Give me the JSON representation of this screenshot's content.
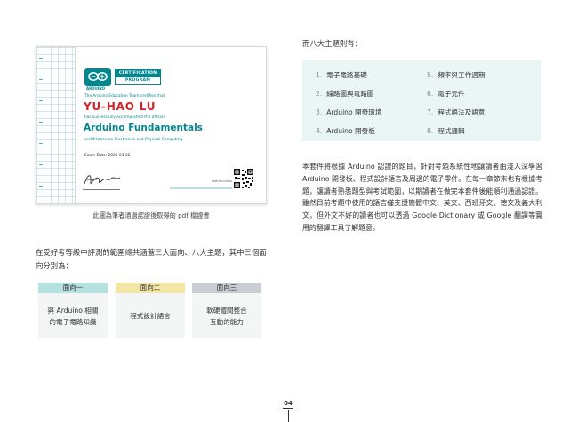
{
  "certificate": {
    "program_line1": "CERTIFICATION",
    "program_line2": "PROGRAM",
    "arduino_word": "ARDUINO",
    "certifies_text": "The Arduino Education Team certifies that",
    "name": "YU-HAO LU",
    "accomplished_text": "has successfully accomplished the official",
    "course": "Arduino Fundamentals",
    "course_sub": "certification on Electronics and Physical Computing",
    "exam_date": "Exam Date:  2020-01-22",
    "verify_label": "CERTIFICATE ID",
    "accent_color": "#00878f",
    "name_color": "#d2232a"
  },
  "caption": "此圖為筆者通過認證後取得的 pdf 檔證書",
  "left_paragraph": "在受好考等級中評測的範圍總共涵蓋三大面向、八大主題，其中三個面向分別為：",
  "aspects": [
    {
      "title": "面向一",
      "body_line1": "與 Arduino 相關",
      "body_line2": "的電子電路知識",
      "color": "#b5e1e1"
    },
    {
      "title": "面向二",
      "body_line1": "程式設計語言",
      "body_line2": "",
      "color": "#f2e7a7"
    },
    {
      "title": "面向三",
      "body_line1": "軟硬體間整合",
      "body_line2": "互動的能力",
      "color": "#c8ced3"
    }
  ],
  "topics_title": "而八大主題則有：",
  "topics": [
    {
      "num": "1.",
      "label": "電子電路基礎"
    },
    {
      "num": "2.",
      "label": "線路圖與電路圖"
    },
    {
      "num": "3.",
      "label": "Arduino 開發環境"
    },
    {
      "num": "4.",
      "label": "Arduino 開發板"
    },
    {
      "num": "5.",
      "label": "頻率與工作週期"
    },
    {
      "num": "6.",
      "label": "電子元件"
    },
    {
      "num": "7.",
      "label": "程式語法及語意"
    },
    {
      "num": "8.",
      "label": "程式邏輯"
    }
  ],
  "right_paragraph": "本套件將根據 Arduino 認證的題目，針對考題系統性地讓讀者由淺入深學習 Arduino 開發板、程式設計語言及周邊的電子零件。在每一章節末也有根據考題，讓讀者熟悉題型與考試範圍，以期讀者在做完本套件後能順利通過認證。雖然目前考題中使用的語言僅支援簡體中文、英文、西班牙文、德文及義大利文，但外文不好的讀者也可以透過 Google Dictionary 或 Google 翻譯等實用的翻譯工具了解題意。",
  "page_number": "04"
}
